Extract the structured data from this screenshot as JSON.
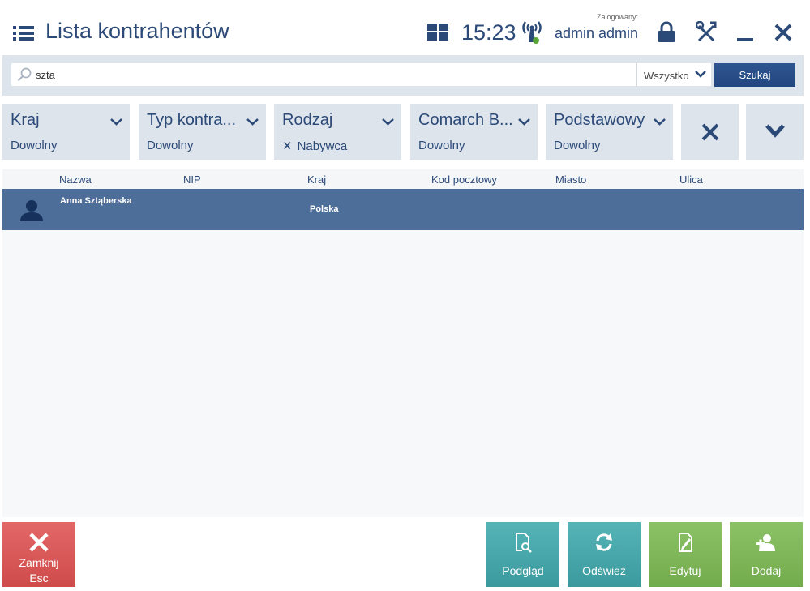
{
  "header": {
    "title": "Lista kontrahentów",
    "time": "15:23",
    "logged_caption": "Zalogowany:",
    "user": "admin admin",
    "icons": [
      "menu-icon",
      "tiles-icon",
      "signal-icon",
      "lock-icon",
      "tools-icon",
      "minimize-icon",
      "close-icon"
    ]
  },
  "search": {
    "value": "szta",
    "scope": "Wszystko",
    "button": "Szukaj"
  },
  "filters": [
    {
      "label": "Kraj",
      "value": "Dowolny",
      "active": false
    },
    {
      "label": "Typ kontra...",
      "value": "Dowolny",
      "active": false
    },
    {
      "label": "Rodzaj",
      "value": "Nabywca",
      "active": true
    },
    {
      "label": "Comarch B...",
      "value": "Dowolny",
      "active": false
    },
    {
      "label": "Podstawowy",
      "value": "Dowolny",
      "active": false
    }
  ],
  "table": {
    "columns": [
      "Nazwa",
      "NIP",
      "Kraj",
      "Kod pocztowy",
      "Miasto",
      "Ulica"
    ],
    "rows": [
      {
        "name": "Anna Sztąberska",
        "nip": "",
        "country": "Polska",
        "postal": "",
        "city": "",
        "street": ""
      }
    ]
  },
  "actions": {
    "close": "Zamknij",
    "close_key": "Esc",
    "preview": "Podgląd",
    "refresh": "Odśwież",
    "edit": "Edytuj",
    "add": "Dodaj"
  },
  "colors": {
    "primary": "#2c4a78",
    "panel": "#dde4ec",
    "selected_row": "#4e6e9a",
    "close_red": "#d95555",
    "teal": "#48a8ab",
    "green": "#7fb75a"
  }
}
